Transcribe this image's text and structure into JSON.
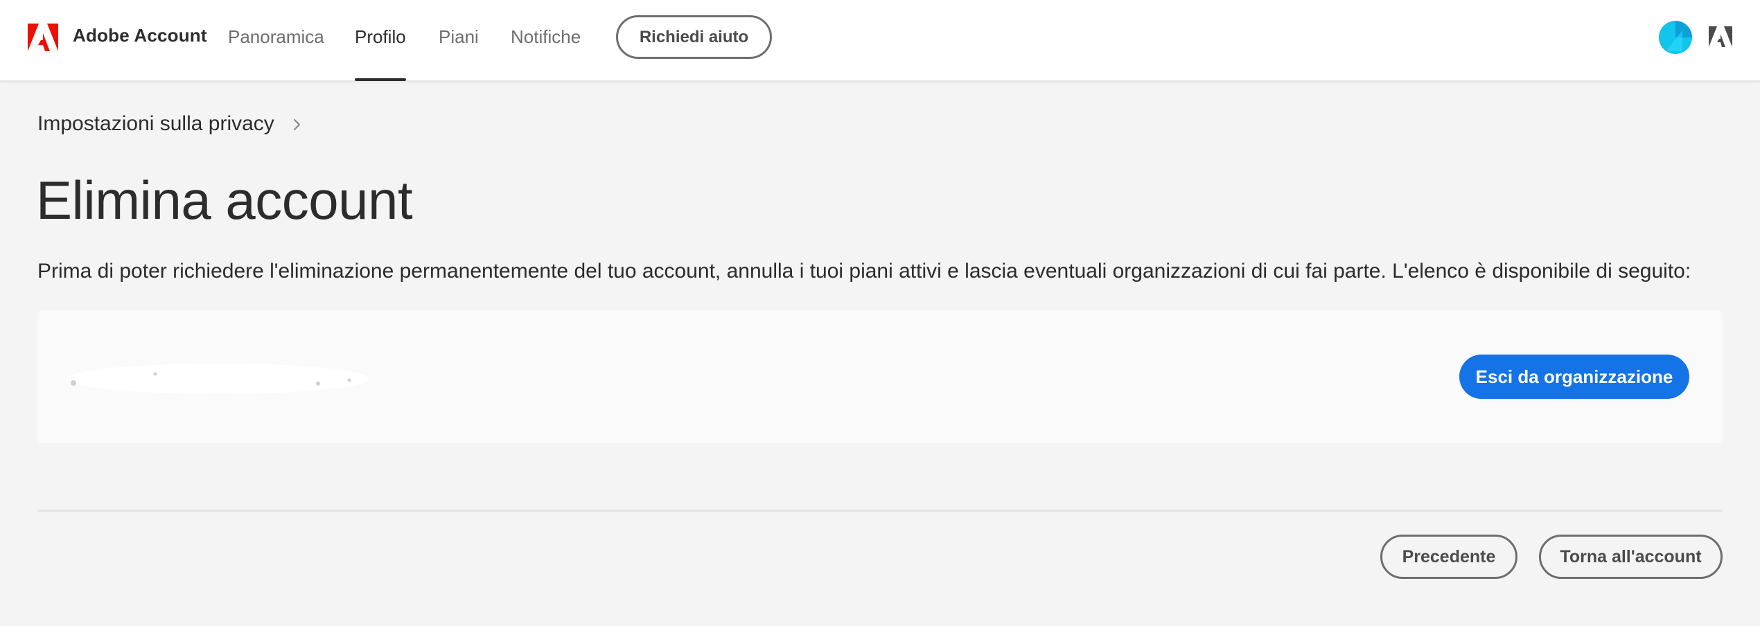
{
  "header": {
    "brand": "Adobe Account",
    "nav": [
      {
        "label": "Panoramica",
        "active": false
      },
      {
        "label": "Profilo",
        "active": true
      },
      {
        "label": "Piani",
        "active": false
      },
      {
        "label": "Notifiche",
        "active": false
      }
    ],
    "help_button": "Richiedi aiuto",
    "logo_icon": "adobe-logo-icon",
    "avatar_color": "#13c4ec",
    "apps_icon": "adobe-apps-icon"
  },
  "breadcrumb": {
    "label": "Impostazioni sulla privacy"
  },
  "page": {
    "title": "Elimina account",
    "intro": "Prima di poter richiedere l'eliminazione permanentemente del tuo account, annulla i tuoi piani attivi e lascia eventuali organizzazioni di cui fai parte. L'elenco è disponibile di seguito:"
  },
  "organization": {
    "leave_button": "Esci da organizzazione"
  },
  "footer": {
    "previous_button": "Precedente",
    "back_button": "Torna all'account"
  },
  "colors": {
    "accent": "#1473e6",
    "adobe_red": "#eb1000"
  }
}
